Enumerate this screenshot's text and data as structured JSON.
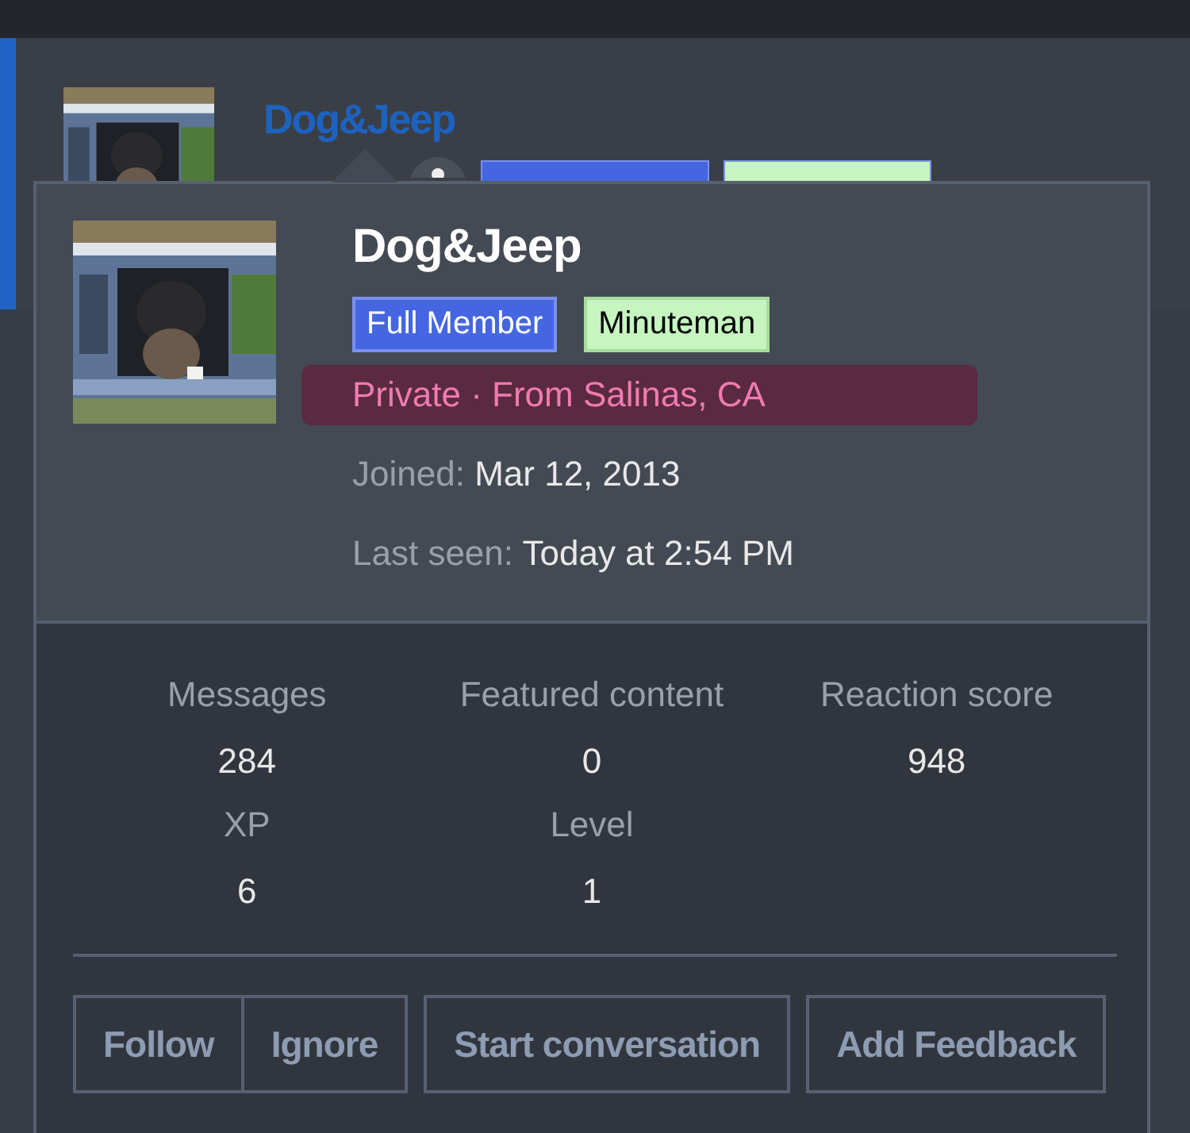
{
  "post_header": {
    "username": "Dog&Jeep",
    "badges": [
      {
        "color": "#4466e0"
      },
      {
        "color": "#c6f5c0"
      }
    ]
  },
  "member_tooltip": {
    "username": "Dog&Jeep",
    "badges": [
      {
        "label": "Full Member",
        "color": "#4466e0"
      },
      {
        "label": "Minuteman",
        "color": "#c6f5c0"
      }
    ],
    "location": {
      "text": "Private · From Salinas, CA",
      "highlighted": true
    },
    "details": [
      {
        "label": "Joined:",
        "value": "Mar 12, 2013"
      },
      {
        "label": "Last seen:",
        "value": "Today at 2:54 PM"
      }
    ],
    "stats": [
      {
        "label": "Messages",
        "value": "284"
      },
      {
        "label": "Featured content",
        "value": "0"
      },
      {
        "label": "Reaction score",
        "value": "948"
      },
      {
        "label": "XP",
        "value": "6"
      },
      {
        "label": "Level",
        "value": "1"
      }
    ],
    "button_groups": [
      [
        "Follow",
        "Ignore"
      ],
      [
        "Start conversation"
      ],
      [
        "Add Feedback"
      ]
    ]
  }
}
